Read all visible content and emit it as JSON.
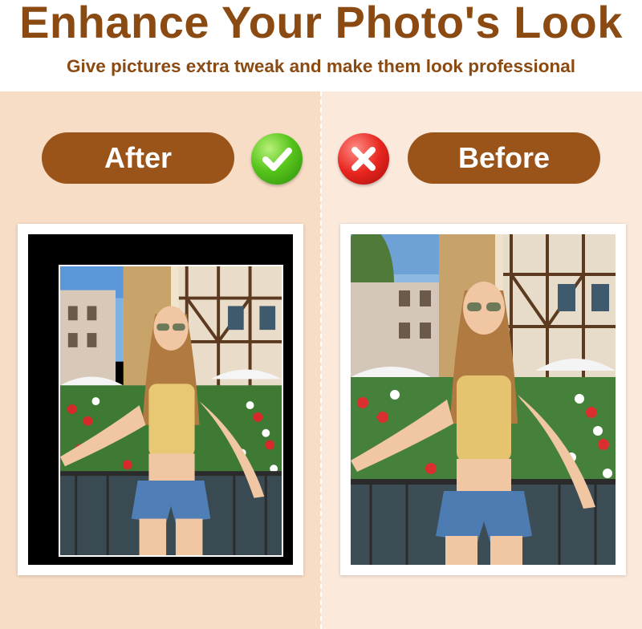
{
  "header": {
    "headline": "Enhance Your Photo's Look",
    "subline": "Give pictures extra tweak and make them look professional"
  },
  "labels": {
    "after": "After",
    "before": "Before"
  },
  "icons": {
    "after_badge": "checkmark-icon",
    "before_badge": "x-mark-icon"
  },
  "colors": {
    "brand_brown": "#9a5319",
    "headline_brown": "#8a4a12",
    "left_panel": "#f7dcc6",
    "right_panel": "#fbe9dc",
    "check_green": "#58c61c",
    "x_red": "#e7261f"
  }
}
